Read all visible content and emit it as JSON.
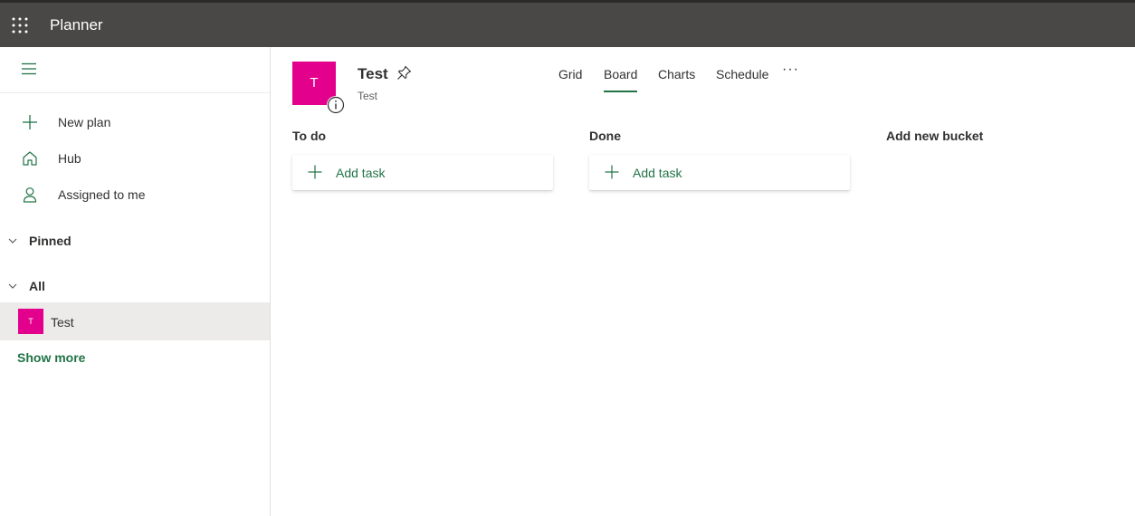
{
  "topbar": {
    "app_title": "Planner",
    "waffle_icon": "app-launcher-icon"
  },
  "sidebar": {
    "menu_icon": "hamburger-icon",
    "nav": [
      {
        "label": "New plan",
        "icon": "plus-icon"
      },
      {
        "label": "Hub",
        "icon": "home-icon"
      },
      {
        "label": "Assigned to me",
        "icon": "person-icon"
      }
    ],
    "sections": [
      {
        "label": "Pinned"
      },
      {
        "label": "All"
      }
    ],
    "plans": [
      {
        "initial": "T",
        "label": "Test"
      }
    ],
    "show_more": "Show more"
  },
  "plan": {
    "initial": "T",
    "title": "Test",
    "group": "Test",
    "accent_color": "#e3008c"
  },
  "tabs": [
    {
      "label": "Grid",
      "active": false
    },
    {
      "label": "Board",
      "active": true
    },
    {
      "label": "Charts",
      "active": false
    },
    {
      "label": "Schedule",
      "active": false
    }
  ],
  "more_label": "···",
  "buckets": [
    {
      "title": "To do",
      "add_task_label": "Add task"
    },
    {
      "title": "Done",
      "add_task_label": "Add task"
    }
  ],
  "add_bucket_label": "Add new bucket",
  "colors": {
    "topbar": "#4a4846",
    "accent_green": "#217346",
    "selected_bg": "#edebe9"
  }
}
